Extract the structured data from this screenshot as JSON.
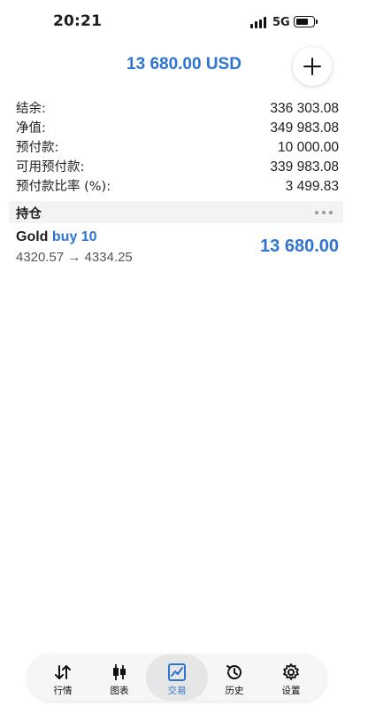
{
  "status_bar": {
    "time": "20:21",
    "network": "5G"
  },
  "header": {
    "total": "13 680.00 USD"
  },
  "summary": [
    {
      "label": "结余:",
      "value": "336 303.08"
    },
    {
      "label": "净值:",
      "value": "349 983.08"
    },
    {
      "label": "预付款:",
      "value": "10 000.00"
    },
    {
      "label": "可用预付款:",
      "value": "339 983.08"
    },
    {
      "label": "预付款比率 (%):",
      "value": "3 499.83"
    }
  ],
  "positions_section": {
    "title": "持仓"
  },
  "positions": [
    {
      "symbol": "Gold",
      "side": "buy 10",
      "prices": "4320.57 → 4334.25",
      "profit": "13 680.00"
    }
  ],
  "tabs": [
    {
      "label": "行情",
      "icon": "arrows-updown-icon",
      "active": false
    },
    {
      "label": "图表",
      "icon": "candlestick-icon",
      "active": false
    },
    {
      "label": "交易",
      "icon": "trade-chart-icon",
      "active": true
    },
    {
      "label": "历史",
      "icon": "history-clock-icon",
      "active": false
    },
    {
      "label": "设置",
      "icon": "gear-icon",
      "active": false
    }
  ],
  "colors": {
    "accent": "#2f74d0",
    "text": "#1f1f1f",
    "muted": "#555555",
    "section_bg": "#f3f3f3"
  }
}
